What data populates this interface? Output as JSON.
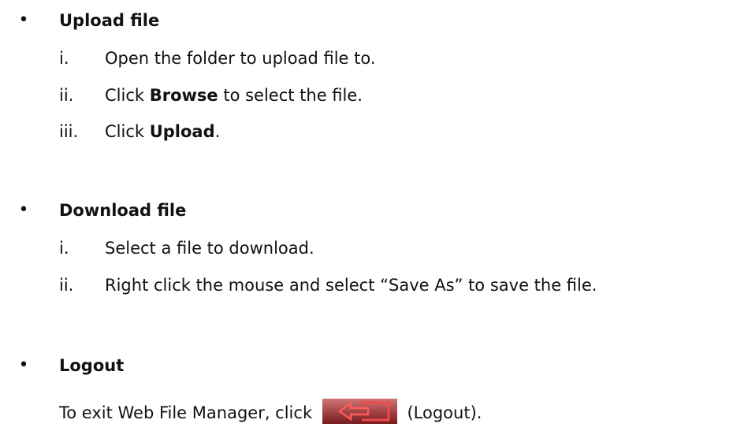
{
  "sections": [
    {
      "title": "Upload file",
      "steps": [
        {
          "num": "i.",
          "parts": [
            {
              "text": "Open the folder to upload file to.",
              "bold": false
            }
          ]
        },
        {
          "num": "ii.",
          "parts": [
            {
              "text": "Click ",
              "bold": false
            },
            {
              "text": "Browse",
              "bold": true
            },
            {
              "text": " to select the file.",
              "bold": false
            }
          ]
        },
        {
          "num": "iii.",
          "parts": [
            {
              "text": "Click ",
              "bold": false
            },
            {
              "text": "Upload",
              "bold": true
            },
            {
              "text": ".",
              "bold": false
            }
          ]
        }
      ]
    },
    {
      "title": "Download file",
      "steps": [
        {
          "num": "i.",
          "parts": [
            {
              "text": "Select a file to download.",
              "bold": false
            }
          ]
        },
        {
          "num": "ii.",
          "parts": [
            {
              "text": "Right click the mouse and select “Save As” to save the file.",
              "bold": false
            }
          ]
        }
      ]
    },
    {
      "title": "Logout",
      "paragraph": {
        "before": "To exit Web File Manager, click",
        "after": "(Logout)."
      }
    }
  ],
  "bullet_glyph": "•",
  "colors": {
    "text": "#111111",
    "logout_icon_fill": "#b8282a",
    "logout_icon_arrow": "#e23a3a"
  },
  "icons": {
    "logout": "logout-arrow-icon"
  }
}
